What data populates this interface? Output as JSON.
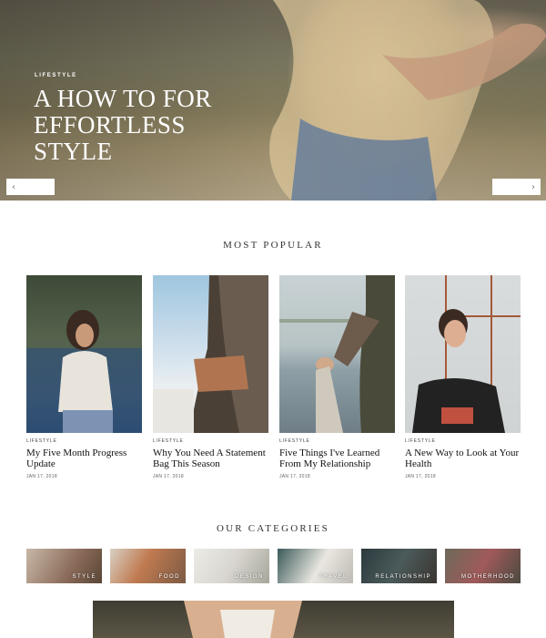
{
  "hero": {
    "category": "LIFESTYLE",
    "title": "A HOW TO FOR EFFORTLESS STYLE",
    "prev_icon": "chevron-left-icon",
    "next_icon": "chevron-right-icon"
  },
  "popular": {
    "heading": "MOST POPULAR",
    "cards": [
      {
        "category": "LIFESTYLE",
        "title": "My Five Month Progress Update",
        "date": "JAN 17, 2018"
      },
      {
        "category": "LIFESTYLE",
        "title": "Why You Need A Statement Bag This Season",
        "date": "JAN 17, 2018"
      },
      {
        "category": "LIFESTYLE",
        "title": "Five Things I've Learned From My Relationship",
        "date": "JAN 17, 2018"
      },
      {
        "category": "LIFESTYLE",
        "title": "A New Way to Look at Your Health",
        "date": "JAN 17, 2018"
      }
    ]
  },
  "categories": {
    "heading": "OUR CATEGORIES",
    "items": [
      {
        "label": "STYLE"
      },
      {
        "label": "FOOD"
      },
      {
        "label": "DESIGN"
      },
      {
        "label": "TRAVEL"
      },
      {
        "label": "RELATIONSHIP"
      },
      {
        "label": "MOTHERHOOD"
      }
    ]
  }
}
